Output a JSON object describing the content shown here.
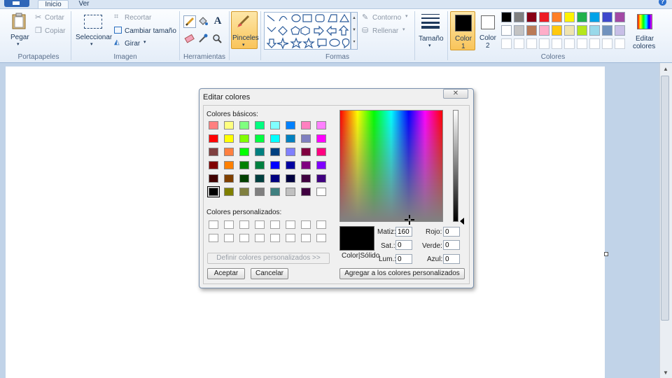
{
  "tabs": {
    "inicio": "Inicio",
    "ver": "Ver"
  },
  "help": "?",
  "portapapeles": {
    "label": "Portapapeles",
    "pegar": "Pegar",
    "cortar": "Cortar",
    "copiar": "Copiar"
  },
  "imagen": {
    "label": "Imagen",
    "seleccionar": "Seleccionar",
    "recortar": "Recortar",
    "cambiar_tamano": "Cambiar tamaño",
    "girar": "Girar"
  },
  "herramientas": {
    "label": "Herramientas"
  },
  "pinceles": {
    "label": "Pinceles"
  },
  "formas": {
    "label": "Formas",
    "contorno": "Contorno",
    "rellenar": "Rellenar"
  },
  "tamano": {
    "label": "Tamaño"
  },
  "color1": {
    "line1": "Color",
    "line2": "1",
    "value": "#000000"
  },
  "color2": {
    "line1": "Color",
    "line2": "2",
    "value": "#ffffff"
  },
  "colores": {
    "label": "Colores",
    "editar_line1": "Editar",
    "editar_line2": "colores",
    "row1": [
      "#000000",
      "#7f7f7f",
      "#880015",
      "#ed1c24",
      "#ff7f27",
      "#fff200",
      "#22b14c",
      "#00a2e8",
      "#3f48cc",
      "#a349a4"
    ],
    "row2": [
      "#ffffff",
      "#c3c3c3",
      "#b97a57",
      "#ffaec9",
      "#ffc90e",
      "#efe4b0",
      "#b5e61d",
      "#99d9ea",
      "#7092be",
      "#c8bfe7"
    ]
  },
  "dialog": {
    "title": "Editar colores",
    "close": "✕",
    "basic_label": "Colores básicos:",
    "custom_label": "Colores personalizados:",
    "define_button": "Definir colores personalizados >>",
    "accept_button": "Aceptar",
    "cancel_button": "Cancelar",
    "add_button": "Agregar a los colores personalizados",
    "color_solido": "Color|Sólido",
    "matiz_label": "Matiz:",
    "matiz": "160",
    "sat_label": "Sat.:",
    "sat": "0",
    "lum_label": "Lum.:",
    "lum": "0",
    "rojo_label": "Rojo:",
    "rojo": "0",
    "verde_label": "Verde:",
    "verde": "0",
    "azul_label": "Azul:",
    "azul": "0",
    "basic_colors": [
      [
        "#ff8080",
        "#ffff80",
        "#80ff80",
        "#00ff80",
        "#80ffff",
        "#0080ff",
        "#ff80c0",
        "#ff80ff"
      ],
      [
        "#ff0000",
        "#ffff00",
        "#80ff00",
        "#00ff40",
        "#00ffff",
        "#0080c0",
        "#8080c0",
        "#ff00ff"
      ],
      [
        "#804040",
        "#ff8040",
        "#00ff00",
        "#008080",
        "#004080",
        "#8080ff",
        "#800040",
        "#ff0080"
      ],
      [
        "#800000",
        "#ff8000",
        "#008000",
        "#008040",
        "#0000ff",
        "#0000a0",
        "#800080",
        "#8000ff"
      ],
      [
        "#400000",
        "#804000",
        "#004000",
        "#004040",
        "#000080",
        "#000040",
        "#400040",
        "#400080"
      ],
      [
        "#000000",
        "#808000",
        "#808040",
        "#808080",
        "#408080",
        "#c0c0c0",
        "#400040",
        "#ffffff"
      ]
    ]
  }
}
